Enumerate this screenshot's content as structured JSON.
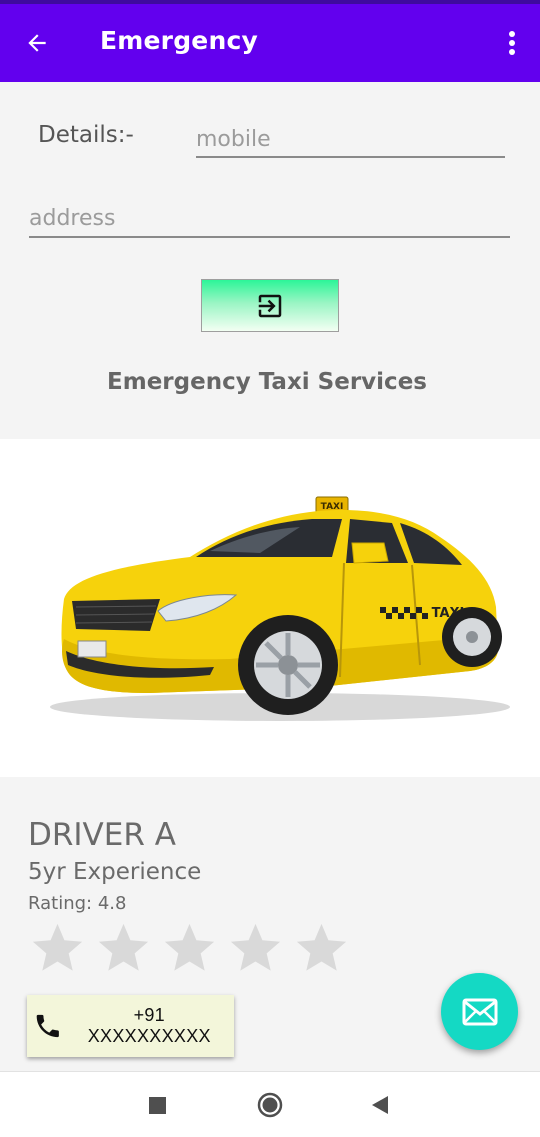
{
  "app_bar": {
    "title": "Emergency",
    "back_icon": "arrow-left-icon",
    "menu_icon": "more-vert-icon",
    "background_color": "#6200ee"
  },
  "form": {
    "details_label": "Details:-",
    "mobile_placeholder": "mobile",
    "mobile_value": "",
    "address_placeholder": "address",
    "address_value": "",
    "submit_icon": "exit-to-app-icon"
  },
  "services_title": "Emergency Taxi Services",
  "hero_image": "yellow-taxi-car-image",
  "driver": {
    "name": "DRIVER A",
    "experience": "5yr Experience",
    "rating_text": "Rating: 4.8",
    "rating_stars_filled": 0,
    "rating_stars_total": 5,
    "phone_icon": "phone-icon",
    "phone_number": "+91 XXXXXXXXXX"
  },
  "fab": {
    "icon": "mail-icon",
    "color": "#14d9c4"
  },
  "nav_bar": {
    "recent_icon": "square-recents-icon",
    "home_icon": "circle-home-icon",
    "back_icon": "triangle-back-icon"
  }
}
